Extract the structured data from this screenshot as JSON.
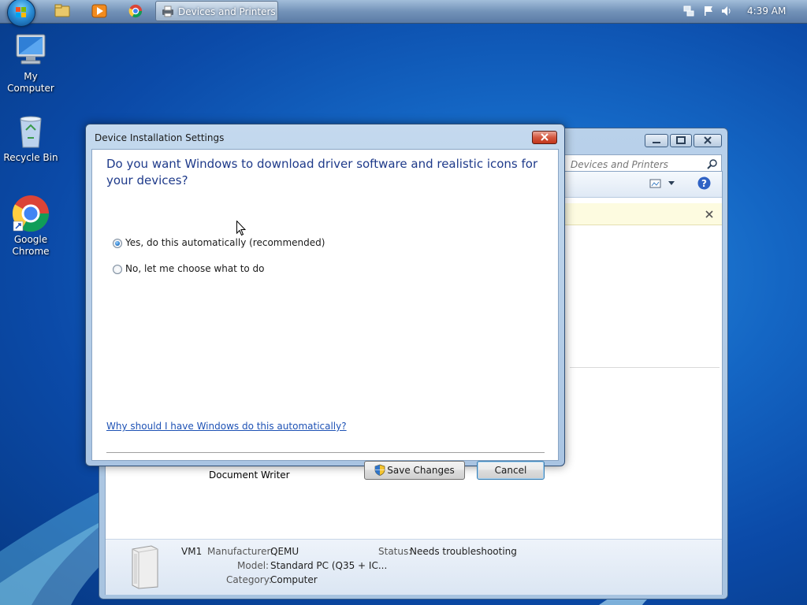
{
  "taskbar": {
    "pinned": [
      {
        "name": "explorer-icon"
      },
      {
        "name": "media-player-icon"
      },
      {
        "name": "chrome-icon"
      }
    ],
    "active_task": {
      "label": "Devices and Printers",
      "icon": "printer-icon"
    },
    "tray": [
      "network-icon",
      "action-center-flag-icon",
      "volume-icon"
    ],
    "clock": "4:39 AM"
  },
  "desktop": {
    "icons": [
      {
        "label": "My Computer",
        "icon": "computer-icon"
      },
      {
        "label": "Recycle Bin",
        "icon": "recycle-bin-icon"
      },
      {
        "label": "Google Chrome",
        "icon": "chrome-icon"
      }
    ]
  },
  "background_window": {
    "search_placeholder": "Devices and Printers",
    "visible_item_label": "Document Writer",
    "details": {
      "name": "VM1",
      "manufacturer_label": "Manufacturer:",
      "manufacturer": "QEMU",
      "model_label": "Model:",
      "model": "Standard PC (Q35 + IC...",
      "category_label": "Category:",
      "category": "Computer",
      "status_label": "Status:",
      "status": "Needs troubleshooting"
    }
  },
  "dialog": {
    "title": "Device Installation Settings",
    "heading": "Do you want Windows to download driver software and realistic icons for your devices?",
    "options": [
      {
        "label": "Yes, do this automatically (recommended)",
        "checked": true
      },
      {
        "label": "No, let me choose what to do",
        "checked": false
      }
    ],
    "help_link": "Why should I have Windows do this automatically?",
    "save_label": "Save Changes",
    "cancel_label": "Cancel"
  }
}
